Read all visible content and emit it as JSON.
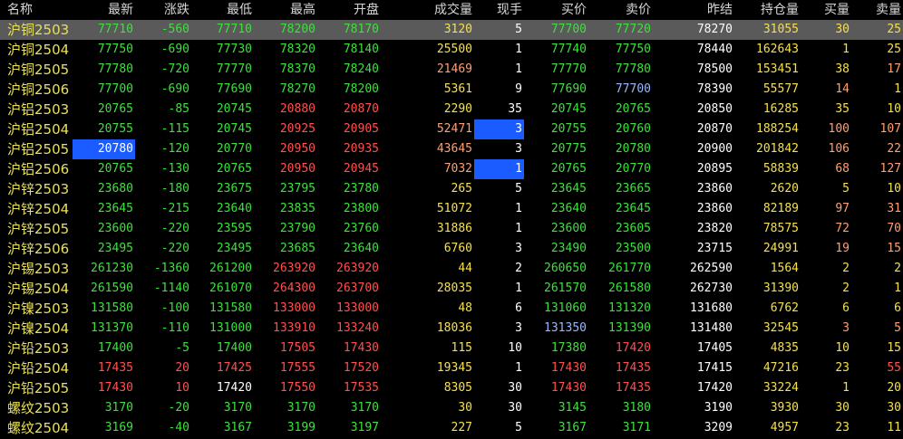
{
  "columns": [
    "名称",
    "最新",
    "涨跌",
    "最低",
    "最高",
    "开盘",
    "成交量",
    "现手",
    "买价",
    "卖价",
    "昨结",
    "持仓量",
    "买量",
    "卖量"
  ],
  "rows": [
    {
      "name": "沪铜2503",
      "last": "77710",
      "chg": "-560",
      "low": "77710",
      "high": "78200",
      "open": "78170",
      "vol": "3120",
      "cur": "5",
      "bid": "77700",
      "ask": "77720",
      "prev": "78270",
      "oi": "31055",
      "bq": "30",
      "aq": "25"
    },
    {
      "name": "沪铜2504",
      "last": "77750",
      "chg": "-690",
      "low": "77730",
      "high": "78320",
      "open": "78140",
      "vol": "25500",
      "cur": "1",
      "bid": "77740",
      "ask": "77750",
      "prev": "78440",
      "oi": "162643",
      "bq": "1",
      "aq": "25"
    },
    {
      "name": "沪铜2505",
      "last": "77780",
      "chg": "-720",
      "low": "77770",
      "high": "78370",
      "open": "78240",
      "vol": "21469",
      "cur": "1",
      "bid": "77770",
      "ask": "77780",
      "prev": "78500",
      "oi": "153451",
      "bq": "38",
      "aq": "17"
    },
    {
      "name": "沪铜2506",
      "last": "77700",
      "chg": "-690",
      "low": "77690",
      "high": "78270",
      "open": "78200",
      "vol": "5361",
      "cur": "9",
      "bid": "77690",
      "ask": "77700",
      "prev": "78390",
      "oi": "55577",
      "bq": "14",
      "aq": "1"
    },
    {
      "name": "沪铝2503",
      "last": "20765",
      "chg": "-85",
      "low": "20745",
      "high": "20880",
      "open": "20870",
      "vol": "2290",
      "cur": "35",
      "bid": "20745",
      "ask": "20765",
      "prev": "20850",
      "oi": "16285",
      "bq": "35",
      "aq": "10"
    },
    {
      "name": "沪铝2504",
      "last": "20755",
      "chg": "-115",
      "low": "20745",
      "high": "20925",
      "open": "20905",
      "vol": "52471",
      "cur": "3",
      "bid": "20755",
      "ask": "20760",
      "prev": "20870",
      "oi": "188254",
      "bq": "100",
      "aq": "107"
    },
    {
      "name": "沪铝2505",
      "last": "20780",
      "chg": "-120",
      "low": "20770",
      "high": "20950",
      "open": "20935",
      "vol": "43645",
      "cur": "3",
      "bid": "20775",
      "ask": "20780",
      "prev": "20900",
      "oi": "201842",
      "bq": "106",
      "aq": "22"
    },
    {
      "name": "沪铝2506",
      "last": "20765",
      "chg": "-130",
      "low": "20765",
      "high": "20950",
      "open": "20945",
      "vol": "7032",
      "cur": "1",
      "bid": "20765",
      "ask": "20770",
      "prev": "20895",
      "oi": "58839",
      "bq": "68",
      "aq": "127"
    },
    {
      "name": "沪锌2503",
      "last": "23680",
      "chg": "-180",
      "low": "23675",
      "high": "23795",
      "open": "23780",
      "vol": "265",
      "cur": "5",
      "bid": "23645",
      "ask": "23665",
      "prev": "23860",
      "oi": "2620",
      "bq": "5",
      "aq": "10"
    },
    {
      "name": "沪锌2504",
      "last": "23645",
      "chg": "-215",
      "low": "23640",
      "high": "23835",
      "open": "23800",
      "vol": "51072",
      "cur": "1",
      "bid": "23640",
      "ask": "23645",
      "prev": "23860",
      "oi": "82189",
      "bq": "97",
      "aq": "31"
    },
    {
      "name": "沪锌2505",
      "last": "23600",
      "chg": "-220",
      "low": "23595",
      "high": "23790",
      "open": "23760",
      "vol": "31886",
      "cur": "1",
      "bid": "23600",
      "ask": "23605",
      "prev": "23820",
      "oi": "78575",
      "bq": "72",
      "aq": "70"
    },
    {
      "name": "沪锌2506",
      "last": "23495",
      "chg": "-220",
      "low": "23495",
      "high": "23685",
      "open": "23640",
      "vol": "6760",
      "cur": "3",
      "bid": "23490",
      "ask": "23500",
      "prev": "23715",
      "oi": "24991",
      "bq": "19",
      "aq": "15"
    },
    {
      "name": "沪锡2503",
      "last": "261230",
      "chg": "-1360",
      "low": "261200",
      "high": "263920",
      "open": "263920",
      "vol": "44",
      "cur": "2",
      "bid": "260650",
      "ask": "261770",
      "prev": "262590",
      "oi": "1564",
      "bq": "2",
      "aq": "2"
    },
    {
      "name": "沪锡2504",
      "last": "261590",
      "chg": "-1140",
      "low": "261070",
      "high": "264300",
      "open": "263700",
      "vol": "28035",
      "cur": "1",
      "bid": "261570",
      "ask": "261580",
      "prev": "262730",
      "oi": "31390",
      "bq": "2",
      "aq": "1"
    },
    {
      "name": "沪镍2503",
      "last": "131580",
      "chg": "-100",
      "low": "131580",
      "high": "133000",
      "open": "133000",
      "vol": "48",
      "cur": "6",
      "bid": "131060",
      "ask": "131320",
      "prev": "131680",
      "oi": "6762",
      "bq": "6",
      "aq": "6"
    },
    {
      "name": "沪镍2504",
      "last": "131370",
      "chg": "-110",
      "low": "131000",
      "high": "133910",
      "open": "133240",
      "vol": "18036",
      "cur": "3",
      "bid": "131350",
      "ask": "131390",
      "prev": "131480",
      "oi": "32545",
      "bq": "3",
      "aq": "5"
    },
    {
      "name": "沪铅2503",
      "last": "17400",
      "chg": "-5",
      "low": "17400",
      "high": "17505",
      "open": "17430",
      "vol": "115",
      "cur": "10",
      "bid": "17380",
      "ask": "17420",
      "prev": "17405",
      "oi": "4835",
      "bq": "10",
      "aq": "15"
    },
    {
      "name": "沪铅2504",
      "last": "17435",
      "chg": "20",
      "low": "17425",
      "high": "17555",
      "open": "17520",
      "vol": "19345",
      "cur": "1",
      "bid": "17430",
      "ask": "17435",
      "prev": "17415",
      "oi": "47216",
      "bq": "23",
      "aq": "55"
    },
    {
      "name": "沪铅2505",
      "last": "17430",
      "chg": "10",
      "low": "17420",
      "high": "17550",
      "open": "17535",
      "vol": "8305",
      "cur": "30",
      "bid": "17430",
      "ask": "17435",
      "prev": "17420",
      "oi": "33224",
      "bq": "1",
      "aq": "20"
    },
    {
      "name": "螺纹2503",
      "last": "3170",
      "chg": "-20",
      "low": "3170",
      "high": "3170",
      "open": "3170",
      "vol": "30",
      "cur": "30",
      "bid": "3145",
      "ask": "3180",
      "prev": "3190",
      "oi": "3930",
      "bq": "30",
      "aq": "30"
    },
    {
      "name": "螺纹2504",
      "last": "3169",
      "chg": "-40",
      "low": "3167",
      "high": "3199",
      "open": "3197",
      "vol": "227",
      "cur": "5",
      "bid": "3167",
      "ask": "3171",
      "prev": "3209",
      "oi": "4957",
      "bq": "23",
      "aq": "11"
    }
  ],
  "colors": {
    "up": "#ff5050",
    "down": "#3ee03e",
    "volume": "#f5e04a",
    "neutral": "#ffffff",
    "flash_volume": "#ffa070",
    "flash_bid": "#9ab8ff",
    "highlight": "#1a5cff",
    "selected_row": "#5a5a5a"
  },
  "selected_row": 0
}
